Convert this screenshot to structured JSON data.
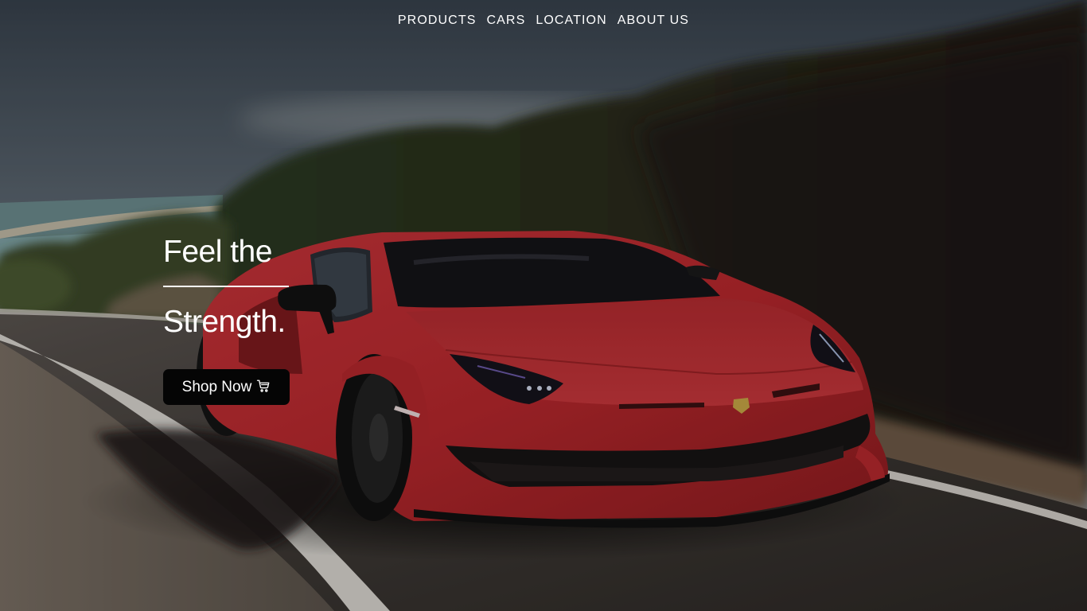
{
  "nav": {
    "items": [
      {
        "label": "PRODUCTS"
      },
      {
        "label": "CARS"
      },
      {
        "label": "LOCATION"
      },
      {
        "label": "ABOUT US"
      }
    ]
  },
  "hero": {
    "headline_line_1": "Feel the",
    "headline_line_2": "Strength.",
    "cta_label": "Shop Now",
    "cta_icon": "shopping-cart-icon",
    "background_image": "red sports car on coastal road",
    "colors": {
      "text": "#ffffff",
      "button_bg": "#050505",
      "car_red": "#c4282c"
    }
  }
}
